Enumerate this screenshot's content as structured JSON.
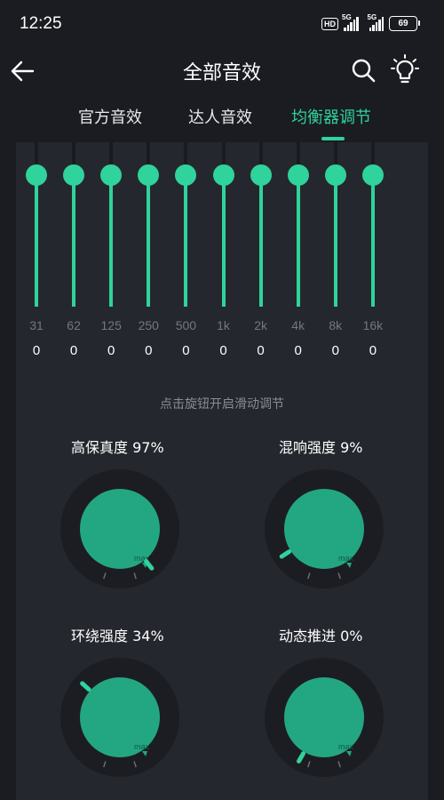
{
  "status_bar": {
    "time": "12:25",
    "hd": "HD",
    "net1": "5G",
    "net2": "5G",
    "battery": "69"
  },
  "header": {
    "title": "全部音效",
    "icons": [
      "back-arrow-icon",
      "search-icon",
      "lightbulb-icon"
    ]
  },
  "tabs": [
    {
      "label": "官方音效",
      "active": false
    },
    {
      "label": "达人音效",
      "active": false
    },
    {
      "label": "均衡器调节",
      "active": true
    }
  ],
  "equalizer": {
    "bands": [
      {
        "freq": "31",
        "gain": "0"
      },
      {
        "freq": "62",
        "gain": "0"
      },
      {
        "freq": "125",
        "gain": "0"
      },
      {
        "freq": "250",
        "gain": "0"
      },
      {
        "freq": "500",
        "gain": "0"
      },
      {
        "freq": "1k",
        "gain": "0"
      },
      {
        "freq": "2k",
        "gain": "0"
      },
      {
        "freq": "4k",
        "gain": "0"
      },
      {
        "freq": "8k",
        "gain": "0"
      },
      {
        "freq": "16k",
        "gain": "0"
      }
    ],
    "hint": "点击旋钮开启滑动调节"
  },
  "knobs": [
    {
      "label": "高保真度 97%",
      "value": 0.97,
      "max_label": "max"
    },
    {
      "label": "混响强度 9%",
      "value": 0.09,
      "max_label": "max"
    },
    {
      "label": "环绕强度 34%",
      "value": 0.34,
      "max_label": "max"
    },
    {
      "label": "动态推进 0%",
      "value": 0.0,
      "max_label": "max"
    }
  ],
  "colors": {
    "accent": "#2fd39b",
    "dial_fill": "#23a783",
    "background": "#1b1c21",
    "panel": "#25272e"
  }
}
